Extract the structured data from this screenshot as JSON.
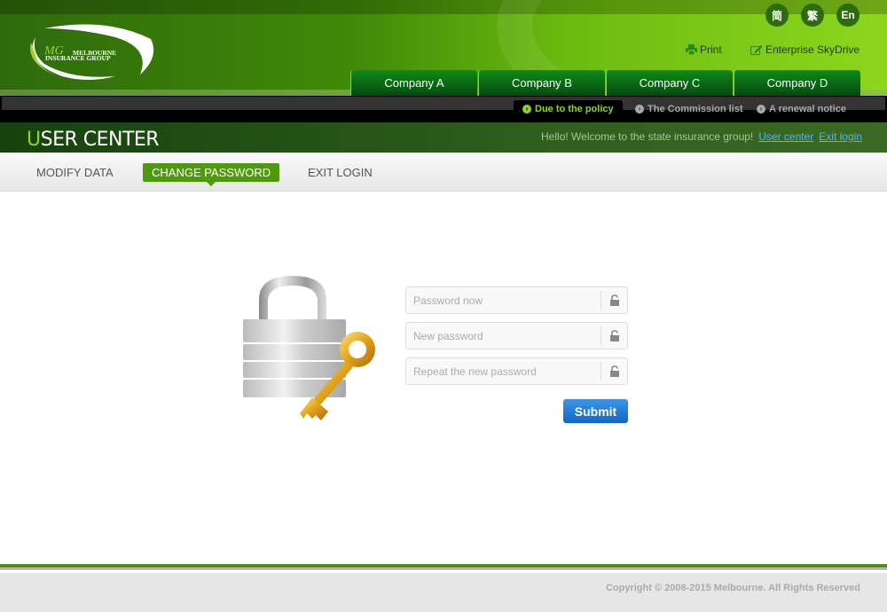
{
  "header": {
    "logo_text": [
      "MELBOURNE",
      "INSURANCE GROUP"
    ],
    "languages": [
      "简",
      "繁",
      "En"
    ],
    "links": [
      {
        "label": "Print",
        "icon": "printer-icon"
      },
      {
        "label": "Enterprise SkyDrive",
        "icon": "edit-icon"
      }
    ],
    "tabs": [
      "Company A",
      "Company B",
      "Company C",
      "Company D"
    ],
    "subnav": [
      {
        "label": "Due to the policy",
        "active": true
      },
      {
        "label": "The Commission list",
        "active": false
      },
      {
        "label": "A renewal notice",
        "active": false
      }
    ]
  },
  "user_center": {
    "title_first": "U",
    "title_rest": "SER CENTER",
    "welcome": "Hello! Welcome to the state insurance group!",
    "user_center_link": "User center",
    "exit_link": "Exit login"
  },
  "menu": [
    "MODIFY DATA",
    "CHANGE PASSWORD",
    "EXIT LOGIN"
  ],
  "menu_active": "CHANGE PASSWORD",
  "form": {
    "current_placeholder": "Password now",
    "new_placeholder": "New password",
    "repeat_placeholder": "Repeat the new password",
    "submit": "Submit"
  },
  "footer": {
    "copyright": "Copyright © 2008-2015 Melbourne. All Rights Reserved"
  },
  "colors": {
    "brand_green": "#4f9a0c",
    "accent_lime": "#8ed61e",
    "link_blue": "#5ab2ee",
    "button_blue": "#1a73d0"
  }
}
